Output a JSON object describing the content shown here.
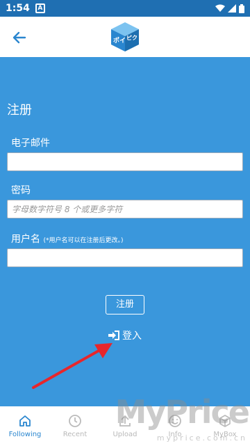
{
  "status_bar": {
    "time": "1:54",
    "app_icon": "A"
  },
  "form": {
    "title": "注册",
    "email": {
      "label": "电子邮件",
      "value": "",
      "placeholder": ""
    },
    "password": {
      "label": "密码",
      "value": "",
      "placeholder": "字母数字符号 8 个或更多字符"
    },
    "username": {
      "label": "用户名",
      "hint": "(*用户名可以在注册后更改。)",
      "value": "",
      "placeholder": ""
    },
    "register_label": "注册",
    "login_label": "登入"
  },
  "bottom_nav": {
    "items": [
      {
        "label": "Following",
        "icon": "home-icon",
        "active": true
      },
      {
        "label": "Recent",
        "icon": "clock-icon",
        "active": false
      },
      {
        "label": "Upload",
        "icon": "upload-icon",
        "active": false
      },
      {
        "label": "Info",
        "icon": "smiley-icon",
        "active": false
      },
      {
        "label": "MyBox",
        "icon": "box-icon",
        "active": false
      }
    ]
  },
  "watermark": {
    "main": "MyPrice",
    "sub": "myprice.com.cn"
  },
  "colors": {
    "background": "#3a97dc",
    "status_bar": "#1f6fb2",
    "accent": "#2a86cf",
    "arrow": "#e8262b"
  }
}
